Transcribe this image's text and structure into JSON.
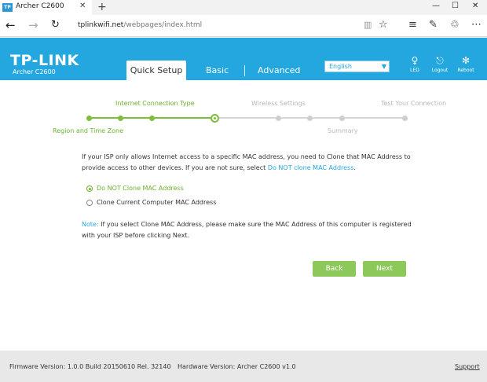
{
  "browser": {
    "tab_favicon": "TP",
    "tab_title": "Archer C2600",
    "tab_close": "✕",
    "new_tab": "+",
    "minimize": "—",
    "maximize": "☐",
    "close": "✕",
    "url_host": "tplinkwifi.net",
    "url_path": "/webpages/index.html",
    "icons": [
      "back-arrow-icon",
      "forward-arrow-icon",
      "refresh-icon",
      "reading-view-icon",
      "favorite-star-icon",
      "hub-icon",
      "web-note-icon",
      "share-icon",
      "more-icon"
    ]
  },
  "header": {
    "brand": "TP-LINK",
    "model": "Archer C2600",
    "tabs": [
      {
        "label": "Quick Setup",
        "active": true
      },
      {
        "label": "Basic",
        "active": false
      },
      {
        "label": "Advanced",
        "active": false
      }
    ],
    "language": "English",
    "actions": [
      {
        "label": "LED",
        "icon": "led-bulb-icon"
      },
      {
        "label": "Logout",
        "icon": "logout-icon"
      },
      {
        "label": "Reboot",
        "icon": "reboot-icon"
      }
    ],
    "colors": {
      "header": "#24a7de"
    }
  },
  "steps": {
    "top_labels": [
      "Internet Connection Type",
      "Wireless Settings",
      "Test Your Connection"
    ],
    "bottom_labels": [
      "Region and Time Zone",
      "Summary"
    ],
    "dot_count": 8,
    "completed": 3,
    "current_index": 3
  },
  "content": {
    "paragraph_before_link": "If your ISP only allows Internet access to a specific MAC address, you need to Clone that MAC Address to provide access to other devices. If you are not sure, select ",
    "paragraph_link": "Do NOT clone MAC Address",
    "paragraph_after_link": ".",
    "options": [
      {
        "label": "Do NOT Clone MAC Address",
        "selected": true
      },
      {
        "label": "Clone Current Computer MAC Address",
        "selected": false
      }
    ],
    "note_label": "Note:",
    "note_text": " If you select Clone MAC Address, please make sure the MAC Address of this computer is registered with your ISP before clicking Next.",
    "back_button": "Back",
    "next_button": "Next",
    "colors": {
      "accent": "#6ab22f",
      "button": "#8dc95a",
      "link": "#24a7de"
    }
  },
  "footer": {
    "firmware": "Firmware Version: 1.0.0 Build 20150610 Rel. 32140",
    "hardware": "Hardware Version: Archer C2600 v1.0",
    "support": "Support"
  }
}
